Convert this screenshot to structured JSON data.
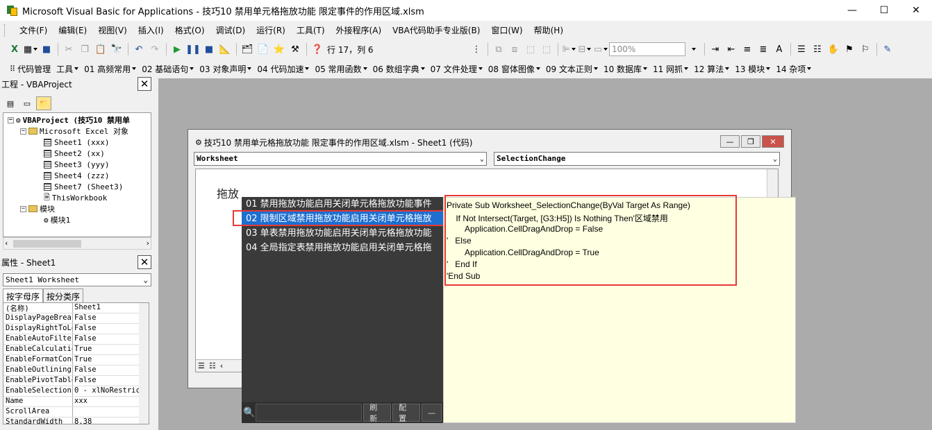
{
  "window": {
    "title": "Microsoft Visual Basic for Applications - 技巧10 禁用单元格拖放功能 限定事件的作用区域.xlsm",
    "min": "—",
    "max": "☐",
    "close": "✕"
  },
  "menu": [
    "文件(F)",
    "编辑(E)",
    "视图(V)",
    "插入(I)",
    "格式(O)",
    "调试(D)",
    "运行(R)",
    "工具(T)",
    "外接程序(A)",
    "VBA代码助手专业版(B)",
    "窗口(W)",
    "帮助(H)"
  ],
  "toolbar": {
    "position": "行 17，列 6",
    "zoom": "100%"
  },
  "toolbar2": [
    "代码管理",
    "工具",
    "01 高频常用",
    "02 基础语句",
    "03 对象声明",
    "04 代码加速",
    "05 常用函数",
    "06 数组字典",
    "07 文件处理",
    "08 窗体图像",
    "09 文本正则",
    "10 数据库",
    "11 网抓",
    "12 算法",
    "13 模块",
    "14 杂项"
  ],
  "project": {
    "title": "工程 - VBAProject",
    "root": "VBAProject (技巧10 禁用单",
    "folder1": "Microsoft Excel 对象",
    "sheets": [
      "Sheet1 (xxx)",
      "Sheet2 (xx)",
      "Sheet3 (yyy)",
      "Sheet4 (zzz)",
      "Sheet7 (Sheet3)",
      "ThisWorkbook"
    ],
    "folder2": "模块",
    "module": "模块1"
  },
  "properties": {
    "title": "属性 - Sheet1",
    "selected": "Sheet1 Worksheet",
    "tab_alpha": "按字母序",
    "tab_cat": "按分类序",
    "rows": [
      [
        "(名称)",
        "Sheet1"
      ],
      [
        "DisplayPageBreak",
        "False"
      ],
      [
        "DisplayRightToLe",
        "False"
      ],
      [
        "EnableAutoFilter",
        "False"
      ],
      [
        "EnableCalculatio",
        "True"
      ],
      [
        "EnableFormatCond",
        "True"
      ],
      [
        "EnableOutlining",
        "False"
      ],
      [
        "EnablePivotTable",
        "False"
      ],
      [
        "EnableSelection",
        "0 - xlNoRestric"
      ],
      [
        "Name",
        "xxx"
      ],
      [
        "ScrollArea",
        ""
      ],
      [
        "StandardWidth",
        "8.38"
      ]
    ]
  },
  "codewin": {
    "title": "技巧10 禁用单元格拖放功能 限定事件的作用区域.xlsm - Sheet1 (代码)",
    "object": "Worksheet",
    "procedure": "SelectionChange",
    "editor_text": "拖放"
  },
  "snippets": {
    "items": [
      "01 禁用拖放功能启用关闭单元格拖放功能事件",
      "02 限制区域禁用拖放功能启用关闭单元格拖放",
      "03 单表禁用拖放功能启用关闭单元格拖放功能",
      "04 全局指定表禁用拖放功能启用关闭单元格拖"
    ],
    "refresh": "刷新",
    "config": "配置",
    "minus": "—"
  },
  "preview": {
    "lines": [
      "Private Sub Worksheet_SelectionChange(ByVal Target As Range)",
      "    If Not Intersect(Target, [G3:H5]) Is Nothing Then'区域禁用",
      "        Application.CellDragAndDrop = False",
      "'   Else",
      "        Application.CellDragAndDrop = True",
      "'   End If",
      "'End Sub"
    ]
  }
}
